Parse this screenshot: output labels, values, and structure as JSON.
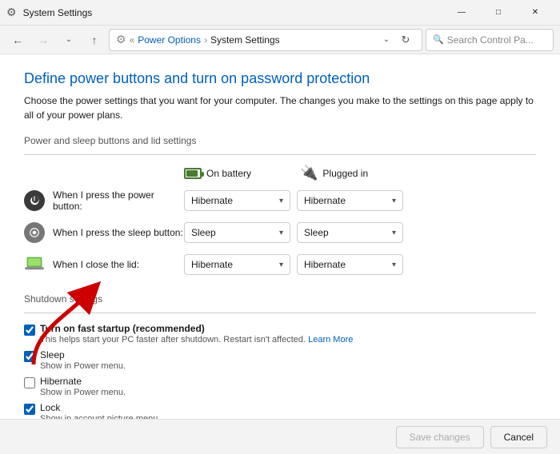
{
  "window": {
    "title": "System Settings",
    "icon": "⚙"
  },
  "titlebar": {
    "minimize": "—",
    "maximize": "□",
    "close": "✕"
  },
  "navbar": {
    "back": "←",
    "forward": "→",
    "dropdown": "⌄",
    "up": "↑",
    "refresh": "↻",
    "breadcrumb": [
      "Power Options",
      "System Settings"
    ],
    "search_placeholder": "Search Control Pa..."
  },
  "content": {
    "page_title": "Define power buttons and turn on password protection",
    "page_desc": "Choose the power settings that you want for your computer. The changes you make to the settings on this page apply to all of your power plans.",
    "section1_label": "Power and sleep buttons and lid settings",
    "col_battery": "On battery",
    "col_plugged": "Plugged in",
    "power_rows": [
      {
        "label": "When I press the power button:",
        "battery_value": "Hibernate",
        "plugged_value": "Hibernate",
        "icon": "power"
      },
      {
        "label": "When I press the sleep button:",
        "battery_value": "Sleep",
        "plugged_value": "Sleep",
        "icon": "sleep"
      },
      {
        "label": "When I close the lid:",
        "battery_value": "Hibernate",
        "plugged_value": "Hibernate",
        "icon": "lid"
      }
    ],
    "shutdown_label": "Shutdown settings",
    "shutdown_items": [
      {
        "checked": true,
        "title": "Turn on fast startup (recommended)",
        "desc": "This helps start your PC faster after shutdown. Restart isn't affected.",
        "link": "Learn More",
        "bold": true
      },
      {
        "checked": true,
        "title": "Sleep",
        "desc": "Show in Power menu.",
        "bold": false
      },
      {
        "checked": false,
        "title": "Hibernate",
        "desc": "Show in Power menu.",
        "bold": false
      },
      {
        "checked": true,
        "title": "Lock",
        "desc": "Show in account picture menu.",
        "bold": false
      }
    ]
  },
  "footer": {
    "save": "Save changes",
    "cancel": "Cancel"
  }
}
